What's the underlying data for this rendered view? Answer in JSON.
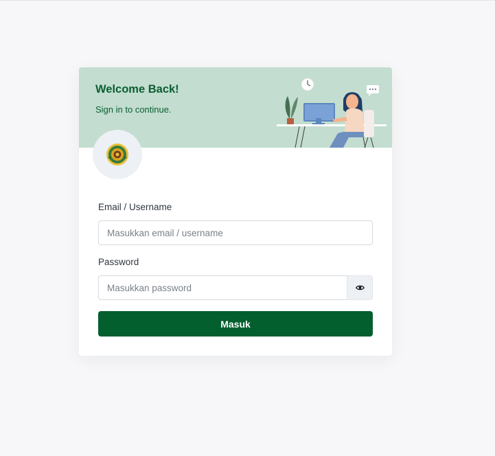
{
  "header": {
    "title": "Welcome Back!",
    "subtitle": "Sign in to continue."
  },
  "logo": {
    "icon": "institution-logo-icon"
  },
  "form": {
    "email_label": "Email / Username",
    "email_placeholder": "Masukkan email / username",
    "email_value": "",
    "password_label": "Password",
    "password_placeholder": "Masukkan password",
    "password_value": "",
    "toggle_icon": "eye-icon",
    "submit_label": "Masuk"
  },
  "colors": {
    "header_bg": "#c3ddd0",
    "brand_green": "#045f2e",
    "page_bg": "#f7f7f9"
  }
}
